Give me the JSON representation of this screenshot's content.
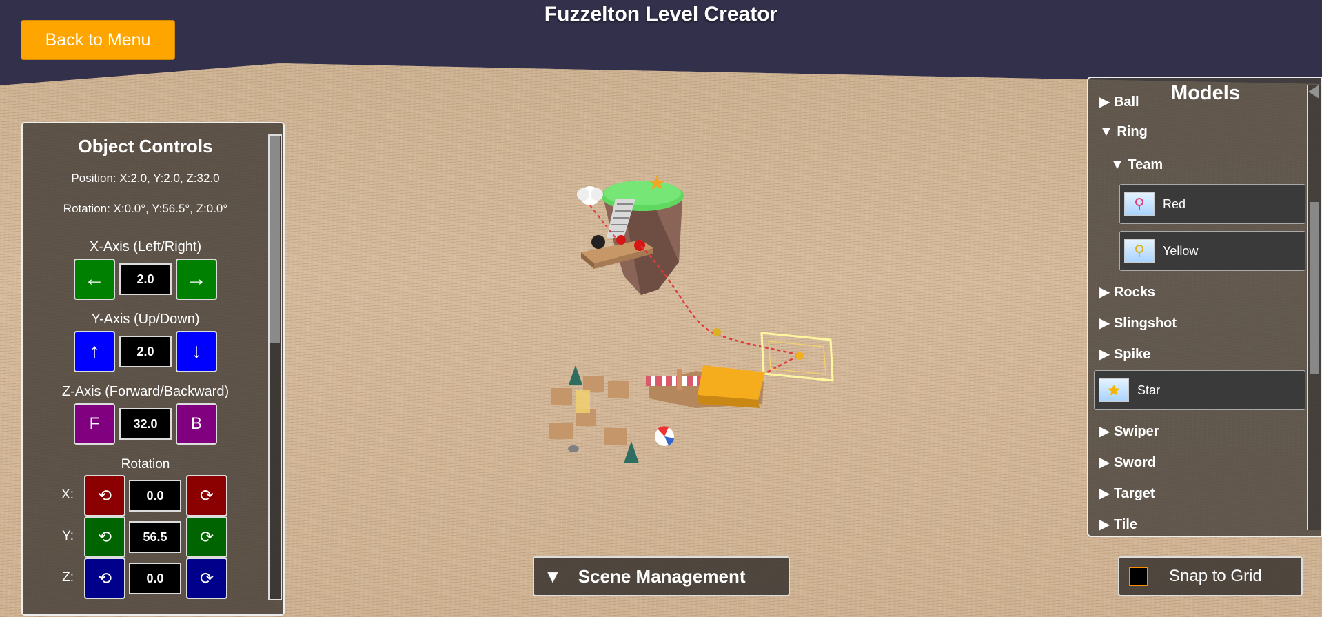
{
  "header": {
    "title": "Fuzzelton Level Creator",
    "back_label": "Back to Menu"
  },
  "object_controls": {
    "title": "Object Controls",
    "position": "Position: X:2.0, Y:2.0, Z:32.0",
    "rotation": "Rotation: X:0.0°, Y:56.5°, Z:0.0°",
    "x_axis": {
      "label": "X-Axis (Left/Right)",
      "value": "2.0",
      "minus": "←",
      "plus": "→"
    },
    "y_axis": {
      "label": "Y-Axis (Up/Down)",
      "value": "2.0",
      "minus": "↑",
      "plus": "↓"
    },
    "z_axis": {
      "label": "Z-Axis (Forward/Backward)",
      "value": "32.0",
      "minus": "F",
      "plus": "B"
    },
    "rotation_section": {
      "label": "Rotation",
      "rows": [
        {
          "axis": "X:",
          "value": "0.0"
        },
        {
          "axis": "Y:",
          "value": "56.5"
        },
        {
          "axis": "Z:",
          "value": "0.0"
        }
      ],
      "ccw_glyph": "⟲",
      "cw_glyph": "⟳"
    }
  },
  "models": {
    "title": "Models",
    "items": [
      {
        "label": "▶ Ball"
      },
      {
        "label": "▼ Ring"
      },
      {
        "label": "▼ Team"
      },
      {
        "label": "Red",
        "thumb_color": "#e0407a"
      },
      {
        "label": "Yellow",
        "thumb_color": "#e0b020"
      },
      {
        "label": "▶ Rocks"
      },
      {
        "label": "▶ Slingshot"
      },
      {
        "label": "▶ Spike"
      },
      {
        "label": "Star",
        "thumb_color": "#f5b400"
      },
      {
        "label": "▶ Swiper"
      },
      {
        "label": "▶ Sword"
      },
      {
        "label": "▶ Target"
      },
      {
        "label": "▶ Tile"
      }
    ]
  },
  "scene_management": {
    "arrow": "▼",
    "label": "Scene Management"
  },
  "snap": {
    "label": "Snap to Grid",
    "checked": false
  },
  "colors": {
    "accent": "#ffa500",
    "sky": "#32304a",
    "ground": "#d2b596"
  }
}
